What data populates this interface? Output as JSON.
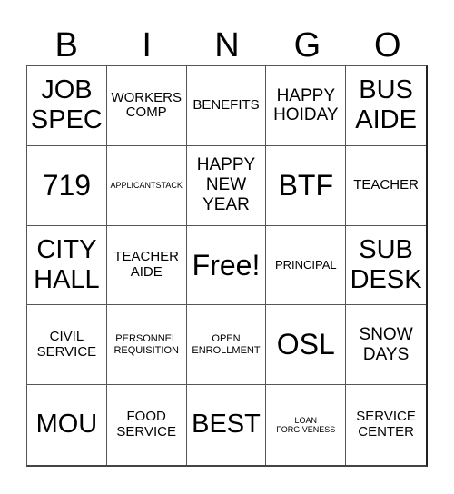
{
  "header": {
    "letters": [
      "B",
      "I",
      "N",
      "G",
      "O"
    ]
  },
  "board": {
    "cells": [
      [
        "JOB SPEC",
        "WORKERS COMP",
        "BENEFITS",
        "HAPPY HOIDAY",
        "BUS AIDE"
      ],
      [
        "719",
        "APPLICANTSTACK",
        "HAPPY NEW YEAR",
        "BTF",
        "TEACHER"
      ],
      [
        "CITY HALL",
        "TEACHER AIDE",
        "Free!",
        "PRINCIPAL",
        "SUB DESK"
      ],
      [
        "CIVIL SERVICE",
        "PERSONNEL REQUISITION",
        "OPEN ENROLLMENT",
        "OSL",
        "SNOW DAYS"
      ],
      [
        "MOU",
        "FOOD SERVICE",
        "BEST",
        "LOAN FORGIVENESS",
        "SERVICE CENTER"
      ]
    ]
  }
}
